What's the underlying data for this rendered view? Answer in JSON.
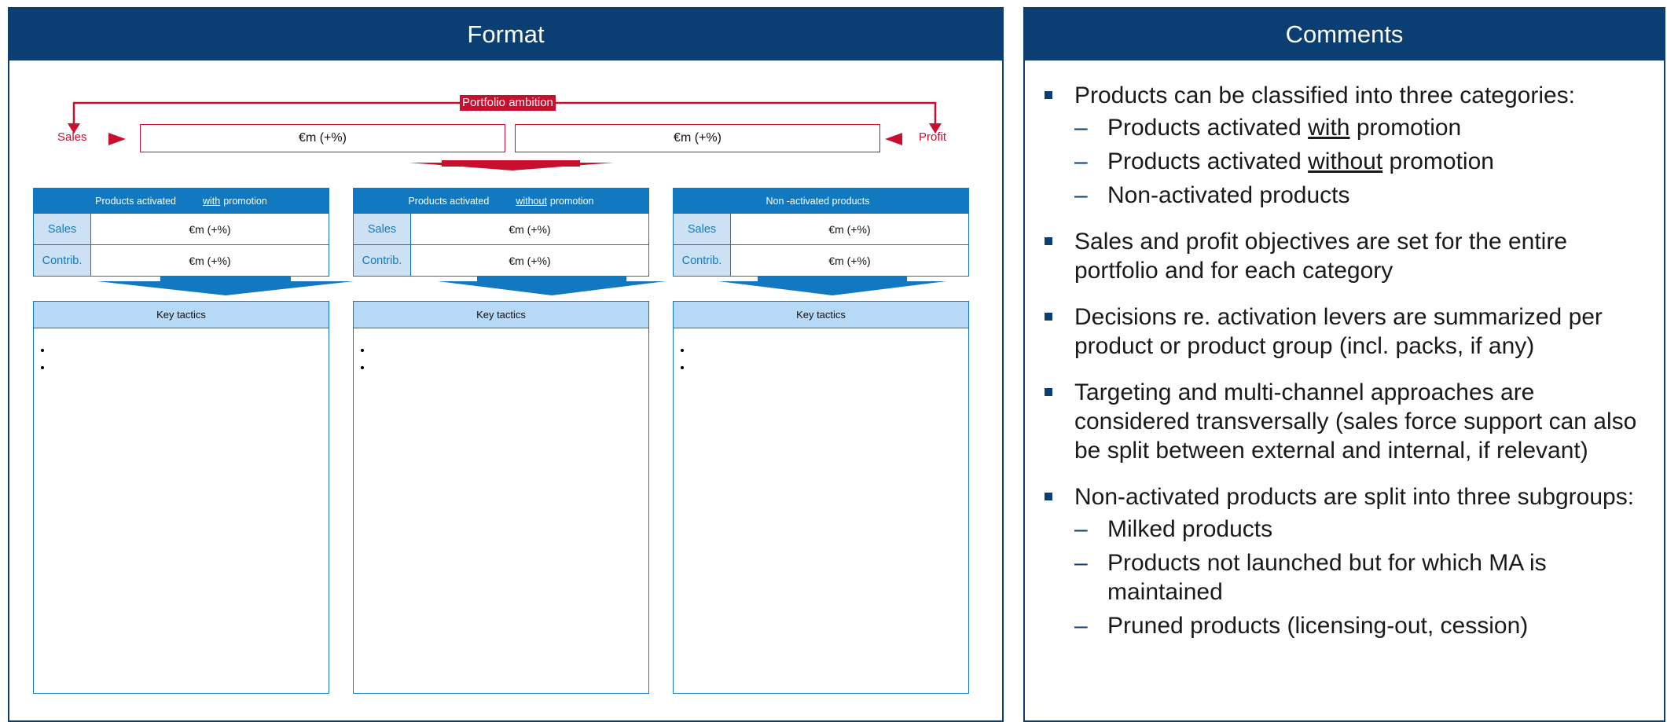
{
  "format_panel": {
    "title": "Format"
  },
  "comments_panel": {
    "title": "Comments"
  },
  "ambition": {
    "label": "Portfolio ambition",
    "sales_label": "Sales",
    "profit_label": "Profit",
    "sales_value": "€m (+%)",
    "profit_value": "€m (+%)",
    "arrow_color": "#c8102e"
  },
  "categories": [
    {
      "title_before": "Products activated",
      "title_emph": "with",
      "title_after": "promotion",
      "rows": [
        {
          "label": "Sales",
          "value": "€m (+%)"
        },
        {
          "label": "Contrib.",
          "value": "€m (+%)"
        }
      ]
    },
    {
      "title_before": "Products activated",
      "title_emph": "without",
      "title_after": "promotion",
      "rows": [
        {
          "label": "Sales",
          "value": "€m (+%)"
        },
        {
          "label": "Contrib.",
          "value": "€m (+%)"
        }
      ]
    },
    {
      "title_before": "Non -activated products",
      "title_emph": "",
      "title_after": "",
      "rows": [
        {
          "label": "Sales",
          "value": "€m (+%)"
        },
        {
          "label": "Contrib.",
          "value": "€m (+%)"
        }
      ]
    }
  ],
  "tactics": [
    {
      "title": "Key tactics",
      "bullets": [
        "",
        ""
      ]
    },
    {
      "title": "Key tactics",
      "bullets": [
        "",
        ""
      ]
    },
    {
      "title": "Key tactics",
      "bullets": [
        "",
        ""
      ]
    }
  ],
  "comments": [
    {
      "text": "Products can be classified into three categories:",
      "sub": [
        {
          "before": "Products activated ",
          "emph": "with",
          "after": " promotion"
        },
        {
          "before": "Products activated ",
          "emph": "without",
          "after": " promotion"
        },
        {
          "before": "Non-activated products",
          "emph": "",
          "after": ""
        }
      ]
    },
    {
      "text": "Sales and profit objectives are set for the entire portfolio and for each category",
      "sub": []
    },
    {
      "text": "Decisions re. activation levers are summarized per product or product group (incl. packs, if any)",
      "sub": []
    },
    {
      "text": "Targeting and multi-channel approaches are considered transversally (sales force support can also be split between external and internal, if relevant)",
      "sub": []
    },
    {
      "text": "Non-activated products are split into three subgroups:",
      "sub": [
        {
          "before": "Milked products",
          "emph": "",
          "after": ""
        },
        {
          "before": "Products not launched but for which MA is maintained",
          "emph": "",
          "after": ""
        },
        {
          "before": "Pruned products (licensing-out, cession)",
          "emph": "",
          "after": ""
        }
      ]
    }
  ],
  "colors": {
    "navy": "#0b3e72",
    "blue": "#1279c0",
    "light_blue": "#b5d9f7",
    "red": "#c8102e"
  }
}
